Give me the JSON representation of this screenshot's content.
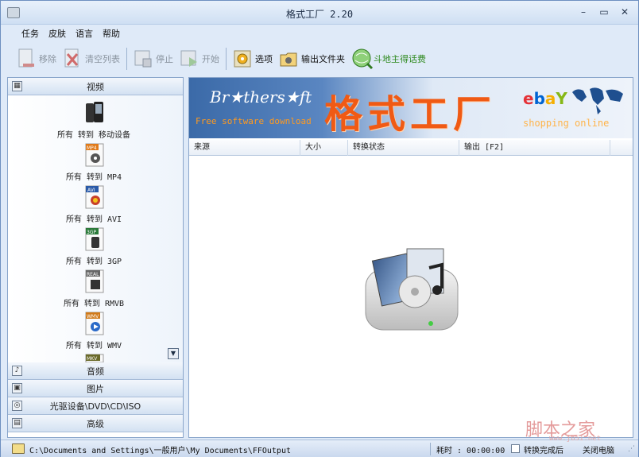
{
  "window": {
    "title": "格式工厂 2.20"
  },
  "menu": [
    "任务",
    "皮肤",
    "语言",
    "帮助"
  ],
  "toolbar": {
    "remove": "移除",
    "clear": "清空列表",
    "stop": "停止",
    "start": "开始",
    "options": "选项",
    "output_folder": "输出文件夹",
    "promo": "斗地主得话费"
  },
  "sidebar": {
    "video": "视频",
    "audio": "音频",
    "image": "图片",
    "rom": "光驱设备\\DVD\\CD\\ISO",
    "advanced": "高级",
    "video_items": [
      {
        "label": "所有 转到 移动设备",
        "badge": ""
      },
      {
        "label": "所有 转到 MP4",
        "badge": "MP4"
      },
      {
        "label": "所有 转到 AVI",
        "badge": "AVI"
      },
      {
        "label": "所有 转到 3GP",
        "badge": "3GP"
      },
      {
        "label": "所有 转到 RMVB",
        "badge": "REAL"
      },
      {
        "label": "所有 转到 WMV",
        "badge": "WMV"
      },
      {
        "label": "",
        "badge": "MKV"
      }
    ]
  },
  "banner": {
    "brand": "Br★thers★ft",
    "tagline": "Free software download",
    "title": "格式工厂",
    "shopping": "shopping online"
  },
  "table": {
    "columns": [
      "来源",
      "大小",
      "转换状态",
      "输出 [F2]"
    ]
  },
  "status": {
    "path": "C:\\Documents and Settings\\一般用户\\My Documents\\FFOutput",
    "elapsed": "耗时 : 00:00:00",
    "after_label": "转换完成后",
    "shutdown_label": "关闭电脑"
  },
  "watermark": {
    "text": "脚本之家",
    "sub": "www.jb51.net"
  },
  "colors": {
    "accent": "#f05a14",
    "chrome": "#d6e4f6",
    "promo_green": "#2f8a1f"
  }
}
